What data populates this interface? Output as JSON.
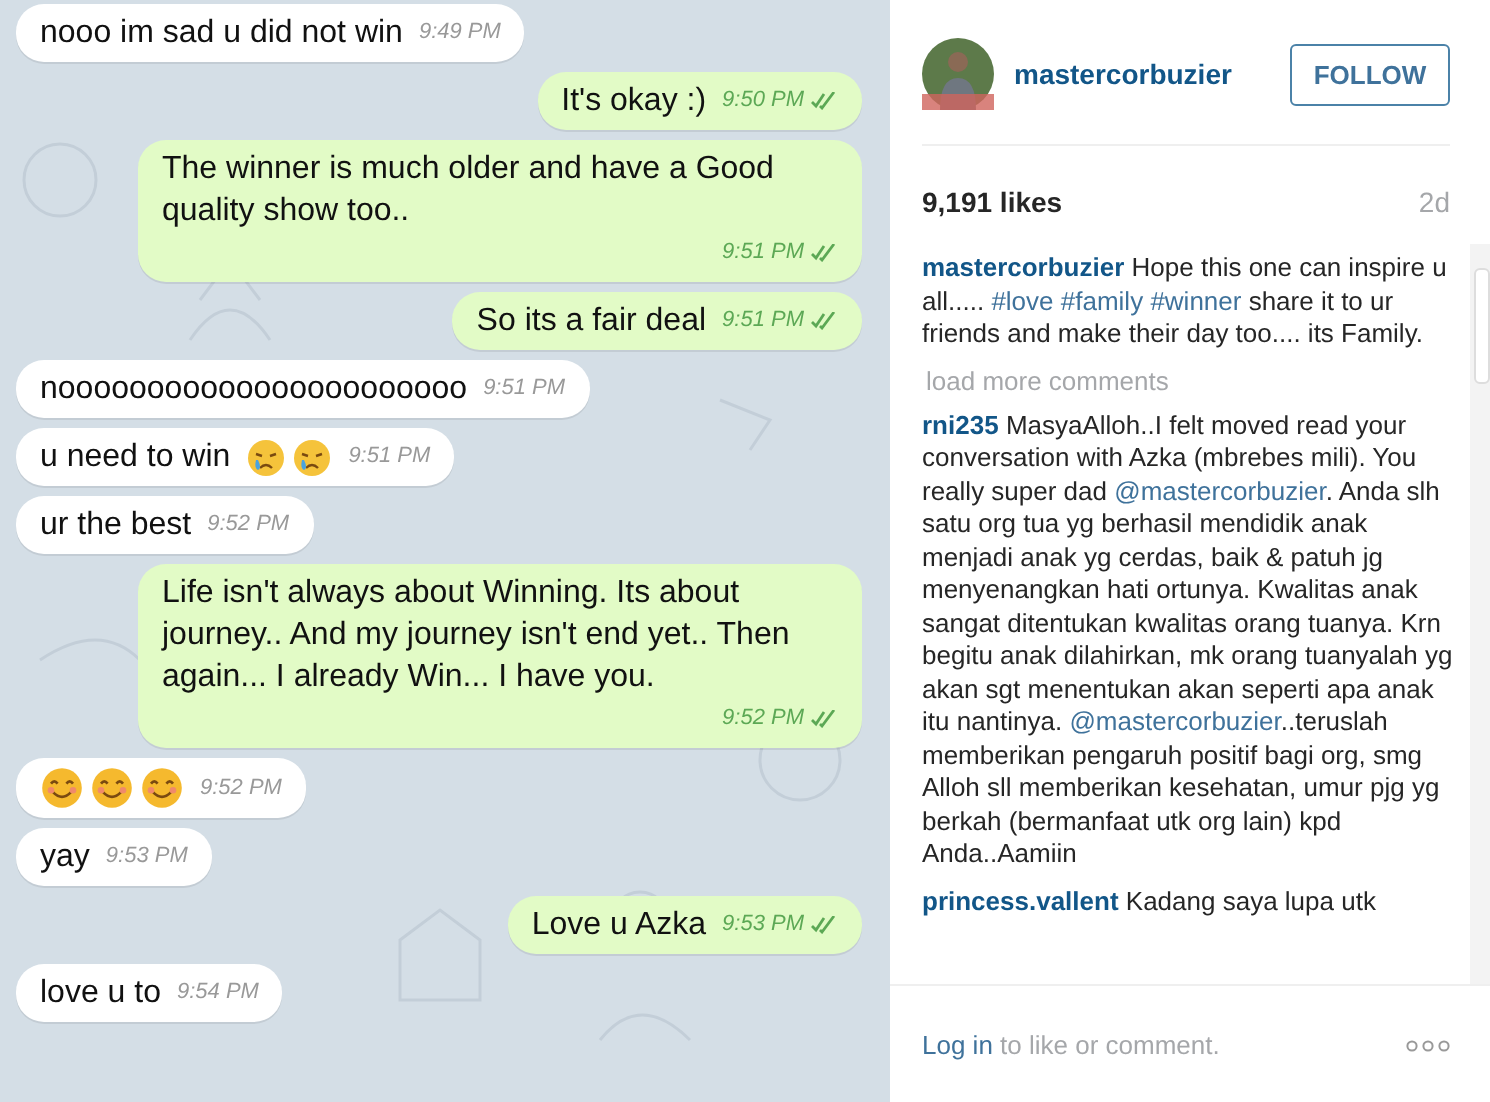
{
  "chat": {
    "messages": [
      {
        "kind": "in",
        "text": "nooo im sad u did not win",
        "time": "9:49 PM"
      },
      {
        "kind": "out",
        "text": "It's okay :)",
        "time": "9:50 PM",
        "read": true
      },
      {
        "kind": "out",
        "text": "The winner is much older and have a Good quality show too..",
        "time": "9:51 PM",
        "read": true
      },
      {
        "kind": "out",
        "text": "So its a fair deal",
        "time": "9:51 PM",
        "read": true
      },
      {
        "kind": "in",
        "text": "nooooooooooooooooooooooo",
        "time": "9:51 PM"
      },
      {
        "kind": "in",
        "text": "u need to win",
        "emoji": [
          {
            "kind": "crying"
          },
          {
            "kind": "crying"
          }
        ],
        "time": "9:51 PM"
      },
      {
        "kind": "in",
        "text": "ur the best",
        "time": "9:52 PM"
      },
      {
        "kind": "out",
        "text": "Life isn't always about Winning. Its about journey.. And my journey isn't end yet.. Then again... I already Win... I have you.",
        "time": "9:52 PM",
        "read": true
      },
      {
        "kind": "in",
        "emoji": [
          {
            "kind": "smile"
          },
          {
            "kind": "smile"
          },
          {
            "kind": "smile"
          }
        ],
        "time": "9:52 PM"
      },
      {
        "kind": "in",
        "text": "yay",
        "time": "9:53 PM"
      },
      {
        "kind": "out",
        "text": "Love u Azka",
        "time": "9:53 PM",
        "read": true
      },
      {
        "kind": "in",
        "text": "love u to",
        "time": "9:54 PM"
      }
    ]
  },
  "post": {
    "username": "mastercorbuzier",
    "follow_button": "FOLLOW",
    "likes": "9,191 likes",
    "age": "2d",
    "comments": [
      {
        "user": "mastercorbuzier",
        "parts": [
          {
            "kind": "text",
            "text": "Hope this one can inspire u all..... "
          },
          {
            "kind": "link",
            "text": "#love "
          },
          {
            "kind": "link",
            "text": "#family "
          },
          {
            "kind": "link",
            "text": "#winner"
          },
          {
            "kind": "text",
            "text": " share it to ur friends and make their day too.... its Family."
          }
        ]
      },
      {
        "kind": "more",
        "text": "load more comments"
      },
      {
        "user": "rni235",
        "parts": [
          {
            "kind": "text",
            "text": "MasyaAlloh..I felt moved read your conversation with Azka (mbrebes mili). You really super dad "
          },
          {
            "kind": "link",
            "text": "@mastercorbuzier"
          },
          {
            "kind": "text",
            "text": ". Anda slh satu org tua yg berhasil mendidik anak menjadi anak yg cerdas, baik & patuh jg menyenangkan hati ortunya. Kwalitas anak sangat ditentukan kwalitas orang tuanya. Krn begitu anak dilahirkan, mk orang tuanyalah yg akan sgt menentukan akan seperti apa anak itu nantinya. "
          },
          {
            "kind": "link",
            "text": "@mastercorbuzier"
          },
          {
            "kind": "text",
            "text": "..teruslah memberikan pengaruh positif bagi org, smg Alloh sll memberikan kesehatan, umur pjg yg berkah (bermanfaat utk org lain) kpd Anda..Aamiin"
          }
        ]
      },
      {
        "user": "princess.vallent",
        "parts": [
          {
            "kind": "text",
            "text": "Kadang saya lupa utk"
          }
        ]
      }
    ],
    "login_prompt": {
      "link": "Log in",
      "text": " to like or comment."
    }
  }
}
